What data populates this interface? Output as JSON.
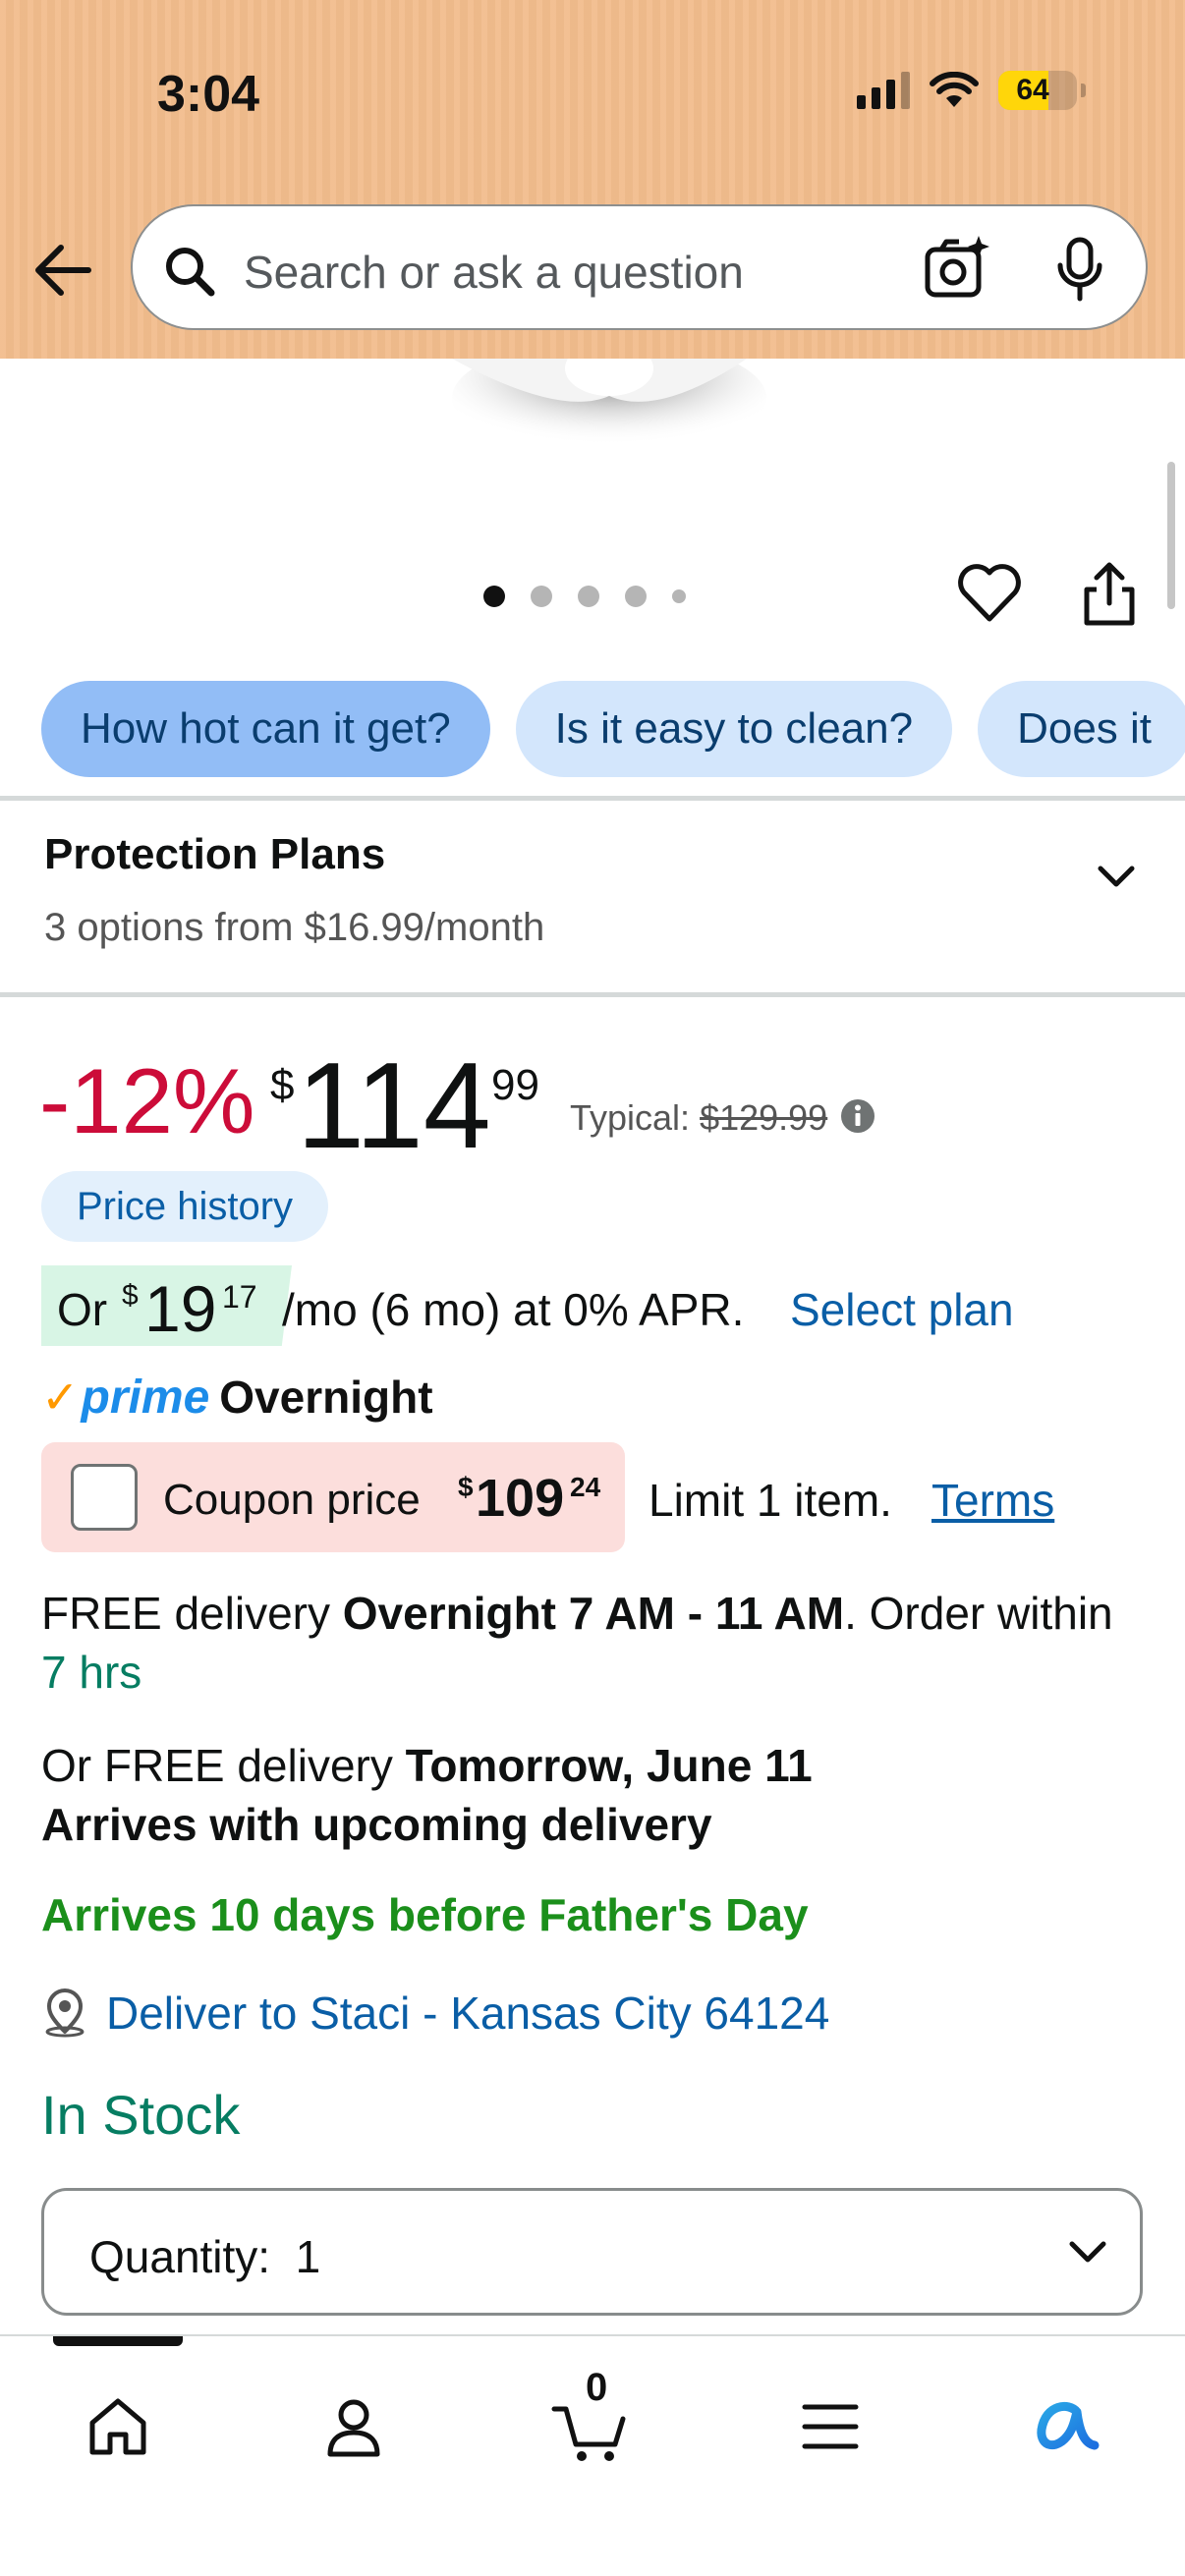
{
  "status_bar": {
    "time": "3:04",
    "battery": "64",
    "battery_level": 0.64
  },
  "header": {
    "search_placeholder": "Search or ask a question"
  },
  "carousel": {
    "dot_count": 5,
    "active_index": 0
  },
  "chips": [
    "How hot can it get?",
    "Is it easy to clean?",
    "Does it"
  ],
  "protection": {
    "title": "Protection Plans",
    "subtitle": "3 options from $16.99/month"
  },
  "price": {
    "discount": "-12%",
    "currency": "$",
    "whole": "114",
    "fraction": "99",
    "typical_label": "Typical:",
    "typical_price": "$129.99",
    "history_label": "Price history"
  },
  "installment": {
    "prefix": "Or",
    "currency": "$",
    "whole": "19",
    "fraction": "17",
    "rest": "/mo (6 mo) at 0% APR.",
    "link": "Select plan"
  },
  "prime": {
    "check": "✓",
    "word": "prime",
    "speed": "Overnight"
  },
  "coupon": {
    "label": "Coupon price",
    "currency": "$",
    "whole": "109",
    "fraction": "24",
    "limit": "Limit 1 item.",
    "terms": "Terms"
  },
  "delivery": {
    "line1_pre": "FREE delivery ",
    "line1_bold": "Overnight 7 AM - 11 AM",
    "line1_post": ". Order within ",
    "line1_time": "7 hrs",
    "line2_pre": "Or FREE delivery ",
    "line2_bold": "Tomorrow, June 11",
    "line3": "Arrives with upcoming delivery",
    "fathers_day": "Arrives 10 days before Father's Day",
    "deliver_to": "Deliver to Staci - Kansas City 64124"
  },
  "stock": "In Stock",
  "quantity": {
    "label": "Quantity:",
    "value": "1"
  },
  "bottom_nav": {
    "cart_count": "0",
    "items": [
      "home-icon",
      "account-icon",
      "cart-icon",
      "menu-icon",
      "rufus-icon"
    ]
  },
  "colors": {
    "header_bg": "#f2bd8d",
    "discount_red": "#cc0c39",
    "link_blue": "#0a5ea6",
    "stock_green": "#067d62",
    "prime_blue": "#1c8ce9",
    "prime_orange": "#ff9900"
  }
}
